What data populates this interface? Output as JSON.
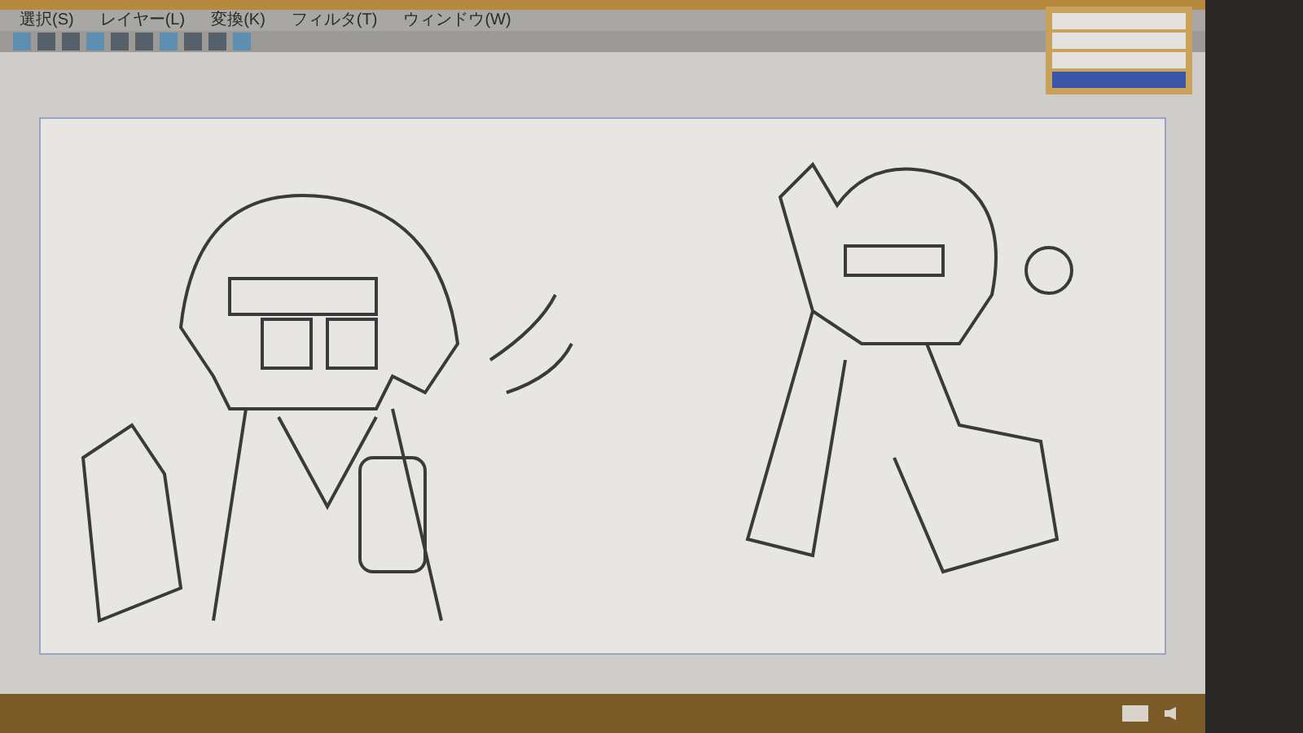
{
  "menu_bar": {
    "items": [
      "選択(S)",
      "レイヤー(L)",
      "変換(K)",
      "フィルタ(T)",
      "ウィンドウ(W)"
    ]
  },
  "layer_panel": {
    "layers": [
      {
        "selected": false
      },
      {
        "selected": false
      },
      {
        "selected": false
      },
      {
        "selected": true
      }
    ]
  }
}
